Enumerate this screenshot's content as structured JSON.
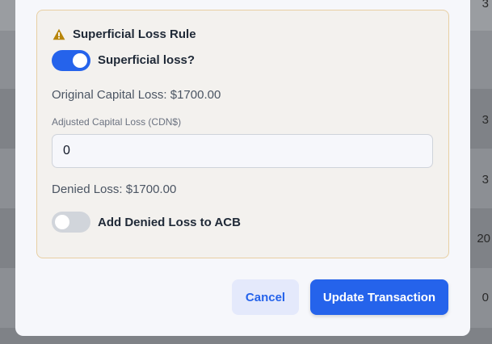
{
  "background_table": {
    "cells": [
      "3",
      "3",
      "3",
      "20",
      "0"
    ]
  },
  "dialog": {
    "section_title": "Superficial Loss Rule",
    "superficial_toggle": {
      "label": "Superficial loss?",
      "checked": true
    },
    "original_capital_loss": "Original Capital Loss: $1700.00",
    "adjusted_field": {
      "label": "Adjusted Capital Loss (CDN$)",
      "value": "0"
    },
    "denied_loss": "Denied Loss: $1700.00",
    "acb_toggle": {
      "label": "Add Denied Loss to ACB",
      "checked": false
    },
    "buttons": {
      "cancel": "Cancel",
      "update": "Update Transaction"
    }
  },
  "colors": {
    "accent": "#2563eb",
    "warning": "#b8860b",
    "panel_border": "#e8cfa3"
  },
  "icons": {
    "warning": "warning-triangle-icon"
  }
}
